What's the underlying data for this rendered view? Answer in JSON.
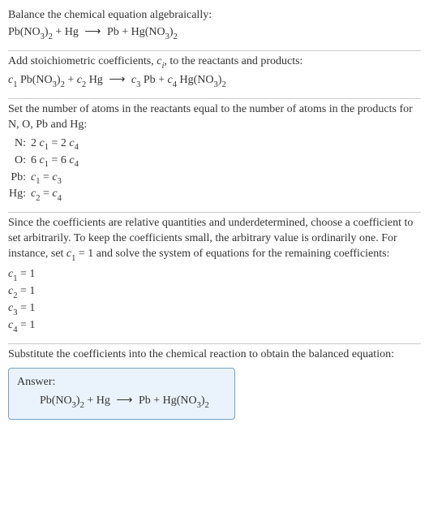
{
  "sec1": {
    "title": "Balance the chemical equation algebraically:",
    "eq": {
      "r1a": "Pb(NO",
      "r1b": ")",
      "r1c": "3",
      "r1d": "2",
      "plus1": " + Hg ",
      "arrow": "⟶",
      "p1": " Pb + Hg(NO",
      "p1b": ")",
      "p1c": "3",
      "p1d": "2"
    }
  },
  "sec2": {
    "title_a": "Add stoichiometric coefficients, ",
    "title_c": "c",
    "title_i": "i",
    "title_b": ", to the reactants and products:",
    "eq": {
      "c1": "c",
      "c1n": "1",
      "sp1": " Pb(NO",
      "sp1b": ")",
      "s3a": "3",
      "s2a": "2",
      "plus1": " + ",
      "c2": "c",
      "c2n": "2",
      "sp2": " Hg ",
      "arrow": "⟶",
      "sp3a": " ",
      "c3": "c",
      "c3n": "3",
      "sp3": " Pb + ",
      "c4": "c",
      "c4n": "4",
      "sp4": " Hg(NO",
      "sp4b": ")",
      "s3b": "3",
      "s2b": "2"
    }
  },
  "sec3": {
    "title": "Set the number of atoms in the reactants equal to the number of atoms in the products for N, O, Pb and Hg:",
    "rows": {
      "N": {
        "label": "N:",
        "lhs_a": "2 ",
        "c1": "c",
        "c1n": "1",
        "eq": " = 2 ",
        "c4": "c",
        "c4n": "4"
      },
      "O": {
        "label": "O:",
        "lhs_a": "6 ",
        "c1": "c",
        "c1n": "1",
        "eq": " = 6 ",
        "c4": "c",
        "c4n": "4"
      },
      "Pb": {
        "label": "Pb:",
        "c1": "c",
        "c1n": "1",
        "eq": " = ",
        "c3": "c",
        "c3n": "3"
      },
      "Hg": {
        "label": "Hg:",
        "c2": "c",
        "c2n": "2",
        "eq": " = ",
        "c4": "c",
        "c4n": "4"
      }
    }
  },
  "sec4": {
    "title_a": "Since the coefficients are relative quantities and underdetermined, choose a coefficient to set arbitrarily. To keep the coefficients small, the arbitrary value is ordinarily one. For instance, set ",
    "c1": "c",
    "c1n": "1",
    "title_b": " = 1 and solve the system of equations for the remaining coefficients:",
    "vals": {
      "l1a": "c",
      "l1n": "1",
      "l1b": " = 1",
      "l2a": "c",
      "l2n": "2",
      "l2b": " = 1",
      "l3a": "c",
      "l3n": "3",
      "l3b": " = 1",
      "l4a": "c",
      "l4n": "4",
      "l4b": " = 1"
    }
  },
  "sec5": {
    "title": "Substitute the coefficients into the chemical reaction to obtain the balanced equation:",
    "answer_label": "Answer:",
    "eq": {
      "r1a": "Pb(NO",
      "r1b": ")",
      "r1c": "3",
      "r1d": "2",
      "plus1": " + Hg ",
      "arrow": "⟶",
      "p1": " Pb + Hg(NO",
      "p1b": ")",
      "p1c": "3",
      "p1d": "2"
    }
  }
}
